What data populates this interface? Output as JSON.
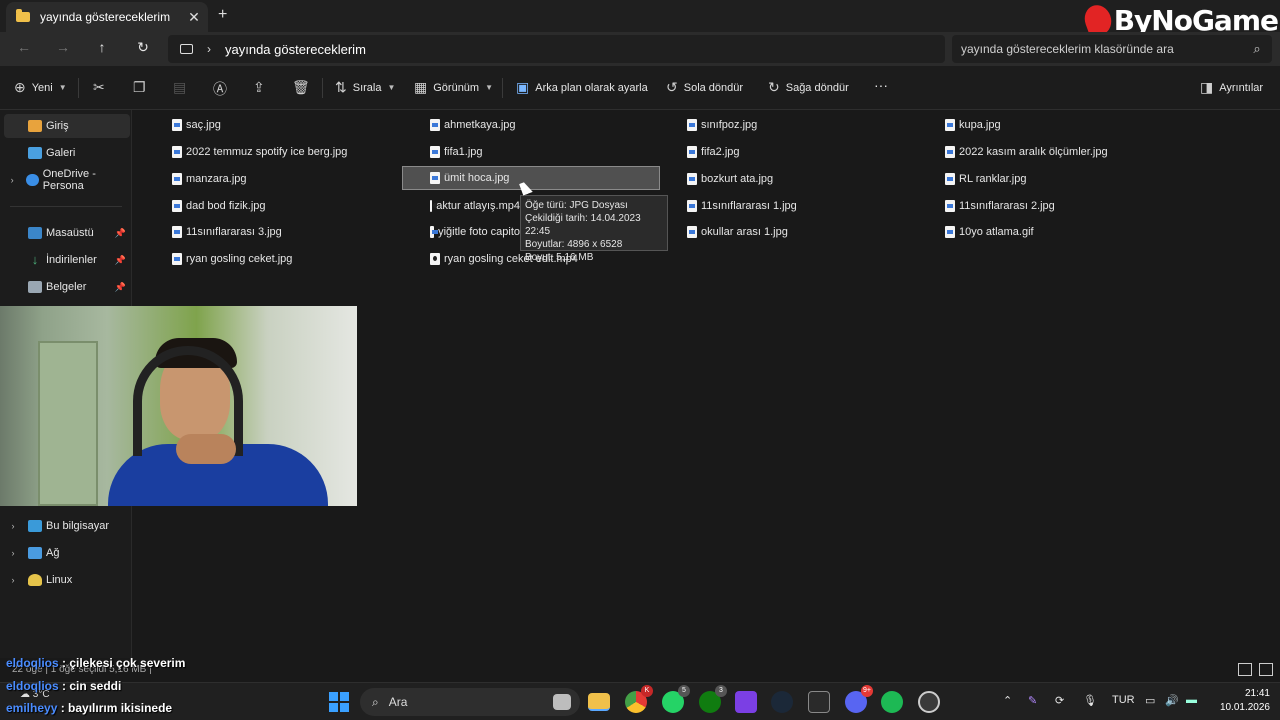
{
  "window": {
    "tab_title": "yayında göstereceklerim",
    "close_glyph": "✕",
    "new_tab_glyph": "+"
  },
  "overlay_logo": "ByNoGame",
  "address": {
    "path": "yayında göstereceklerim",
    "search_placeholder": "yayında göstereceklerim klasöründe ara"
  },
  "toolbar": {
    "new_label": "Yeni",
    "sort_label": "Sırala",
    "view_label": "Görünüm",
    "set_background_label": "Arka plan olarak ayarla",
    "rotate_left_label": "Sola döndür",
    "rotate_right_label": "Sağa döndür",
    "more_label": "···",
    "details_label": "Ayrıntılar"
  },
  "sidebar": {
    "items": [
      {
        "label": "Giriş"
      },
      {
        "label": "Galeri"
      },
      {
        "label": "OneDrive - Persona"
      },
      {
        "label": "Masaüstü"
      },
      {
        "label": "İndirilenler"
      },
      {
        "label": "Belgeler"
      },
      {
        "label": "Bu bilgisayar"
      },
      {
        "label": "Ağ"
      },
      {
        "label": "Linux"
      }
    ]
  },
  "files": {
    "col1": [
      "saç.jpg",
      "2022 temmuz spotify ice berg.jpg",
      "manzara.jpg",
      "dad bod fizik.jpg",
      "11sınıflararası 3.jpg",
      "ryan gosling ceket.jpg"
    ],
    "col2": [
      "ahmetkaya.jpg",
      "fifa1.jpg",
      "ümit hoca.jpg",
      "aktur atlayış.mp4",
      "yiğitle foto capito",
      "ryan gosling ceket edit.mp4"
    ],
    "col3": [
      "sınıfpoz.jpg",
      "fifa2.jpg",
      "bozkurt ata.jpg",
      "11sınıflararası 1.jpg",
      "okullar arası 1.jpg"
    ],
    "col4": [
      "kupa.jpg",
      "2022 kasım aralık ölçümler.jpg",
      "RL ranklar.jpg",
      "11sınıflararası 2.jpg",
      "10yo atlama.gif"
    ]
  },
  "tooltip": {
    "type": "Öğe türü: JPG Dosyası",
    "date": "Çekildiği tarih: 14.04.2023 22:45",
    "dimensions": "Boyutlar: 4896 x 6528",
    "size": "Boyut: 5,16 MB"
  },
  "status": {
    "text": "22 öğe  |  1 öğe seçildi  5,16 MB  |"
  },
  "chat": [
    {
      "user": "eldoqlios",
      "message": " : çilekesi çok severim"
    },
    {
      "user": "eldoqlios",
      "message": " : cin seddi"
    },
    {
      "user": "emilheyy",
      "message": " : bayılırım ikisinede"
    }
  ],
  "taskbar": {
    "weather": "3°C",
    "search_label": "Ara",
    "badges": {
      "chrome": "K",
      "whatsapp": "5",
      "xbox": "3",
      "discord": "9+"
    },
    "language": "TUR",
    "time": "21:41",
    "date": "10.01.2026"
  }
}
